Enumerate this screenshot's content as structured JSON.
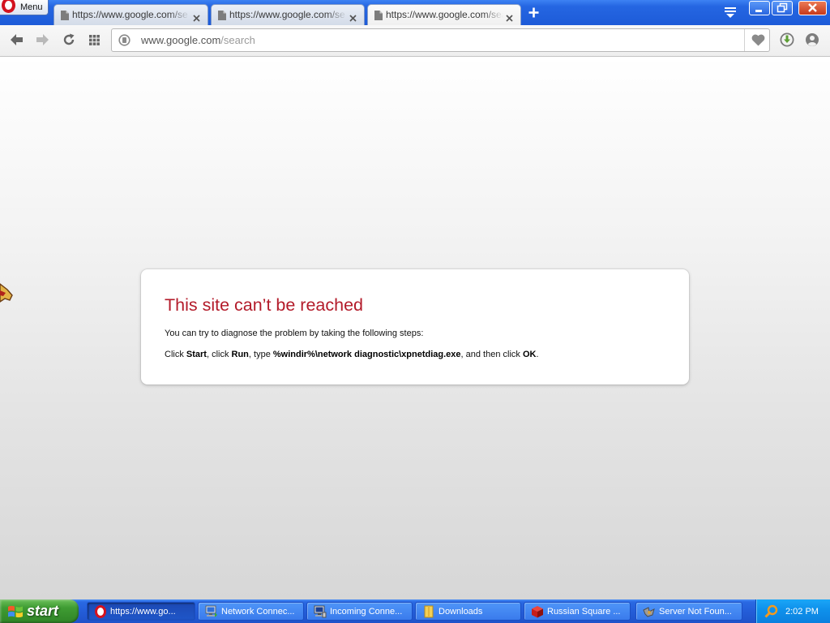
{
  "browser": {
    "menu_label": "Menu",
    "tabs": [
      {
        "title": "https://www.google.com/se",
        "active": false
      },
      {
        "title": "https://www.google.com/se",
        "active": false
      },
      {
        "title": "https://www.google.com/sea",
        "active": true
      }
    ],
    "address": {
      "host": "www.google.com",
      "path": "/search"
    },
    "icons": {
      "logo": "opera-logo-icon",
      "toolbar": [
        "back-arrow-icon",
        "forward-arrow-icon",
        "reload-icon",
        "speed-dial-icon",
        "security-icon",
        "heart-icon",
        "download-icon",
        "profile-icon"
      ]
    }
  },
  "page": {
    "error_title": "This site can’t be reached",
    "intro": "You can try to diagnose the problem by taking the following steps:",
    "instruction": [
      "Click ",
      "Start",
      ", click ",
      "Run",
      ", type ",
      "%windir%\\network diagnostic\\xpnetdiag.exe",
      ", and then click ",
      "OK",
      "."
    ]
  },
  "taskbar": {
    "start_label": "start",
    "tasks": [
      {
        "label": "https://www.go...",
        "icon": "opera-icon",
        "active": true
      },
      {
        "label": "Network Connec...",
        "icon": "network-connections-icon",
        "active": false
      },
      {
        "label": "Incoming Conne...",
        "icon": "incoming-connections-icon",
        "active": false
      },
      {
        "label": "Downloads",
        "icon": "folder-icon",
        "active": false
      },
      {
        "label": "Russian Square ...",
        "icon": "red-cube-icon",
        "active": false
      },
      {
        "label": "Server Not Foun...",
        "icon": "server-error-icon",
        "active": false
      }
    ],
    "clock": "2:02 PM"
  },
  "colors": {
    "error_title": "#b31b2a",
    "taskbar_blue": "#245dd8",
    "start_green": "#3f9c33",
    "tray_blue": "#0f92ec"
  }
}
